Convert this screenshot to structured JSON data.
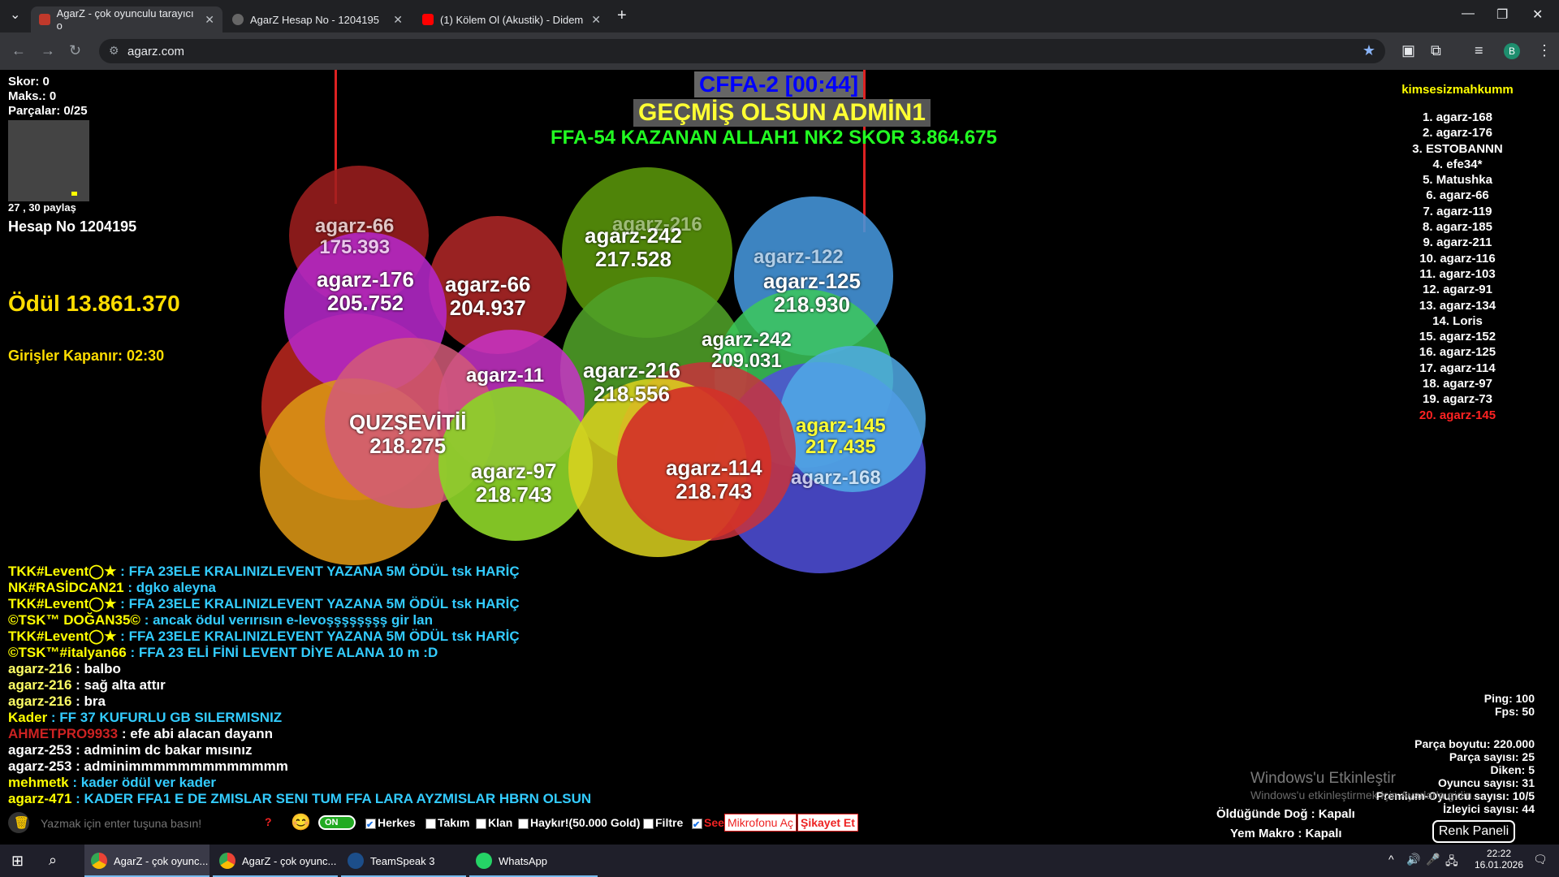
{
  "browser": {
    "tabs": [
      {
        "label": "AgarZ - çok oyunculu tarayıcı o",
        "active": true
      },
      {
        "label": "AgarZ Hesap No - 1204195",
        "active": false
      },
      {
        "label": "(1) Kölem Ol (Akustik) - Didem",
        "active": false
      }
    ],
    "url": "agarz.com"
  },
  "hud": {
    "skor": "Skor: 0",
    "maks": "Maks.: 0",
    "parcalar": "Parçalar: 0/25",
    "coords": "27 , 30 paylaş",
    "hesap": "Hesap No 1204195",
    "odul": "Ödül 13.861.370",
    "girisler": "Girişler Kapanır: 02:30"
  },
  "center": {
    "title": "CFFA-2 [00:44]",
    "message": "GEÇMİŞ OLSUN  ADMİN1",
    "winner": "FFA-54 KAZANAN ALLAH1 NK2 SKOR 3.864.675"
  },
  "cells": [
    {
      "name": "agarz-66",
      "score": "175.393"
    },
    {
      "name": "agarz-176",
      "score": "205.752"
    },
    {
      "name": "agarz-66",
      "score": "204.937"
    },
    {
      "name": "agarz-242",
      "score": "217.528"
    },
    {
      "name": "agarz-216",
      "score": ""
    },
    {
      "name": "agarz-122",
      "score": ""
    },
    {
      "name": "agarz-125",
      "score": "218.930"
    },
    {
      "name": "agarz-242",
      "score": "209.031"
    },
    {
      "name": "agarz-216",
      "score": "218.556"
    },
    {
      "name": "agarz-11",
      "score": ""
    },
    {
      "name": "QUZŞEVİTİİ",
      "score": "218.275"
    },
    {
      "name": "agarz-97",
      "score": "218.743"
    },
    {
      "name": "agarz-114",
      "score": "218.743"
    },
    {
      "name": "agarz-145",
      "score": "217.435"
    },
    {
      "name": "agarz-168",
      "score": ""
    }
  ],
  "leaderboard": {
    "title": "kimsesizmahkumm",
    "items": [
      "1. agarz-168",
      "2. agarz-176",
      "3. ESTOBANNN",
      "4. efe34*",
      "5. Matushka",
      "6. agarz-66",
      "7. agarz-119",
      "8. agarz-185",
      "9. agarz-211",
      "10. agarz-116",
      "11. agarz-103",
      "12. agarz-91",
      "13. agarz-134",
      "14. Loris",
      "15. agarz-152",
      "16. agarz-125",
      "17. agarz-114",
      "18. agarz-97",
      "19. agarz-73",
      "20. agarz-145"
    ]
  },
  "chat": [
    {
      "name": "TKK#Levent◯★",
      "text": "FFA 23ELE KRALINIZLEVENT YAZANA 5M ÖDÜL tsk HARİÇ",
      "name_color": "#ffff00",
      "text_color": "#33ccff"
    },
    {
      "name": "NK#RASİDCAN21",
      "text": "dgko aleyna",
      "name_color": "#ffff00",
      "text_color": "#33ccff"
    },
    {
      "name": "TKK#Levent◯★",
      "text": "FFA 23ELE KRALINIZLEVENT YAZANA 5M ÖDÜL tsk HARİÇ",
      "name_color": "#ffff00",
      "text_color": "#33ccff"
    },
    {
      "name": "©TSK™ DOĞAN35©",
      "text": "ancak ödul verırısın e-levoşşşşşşşş gir lan",
      "name_color": "#ffff00",
      "text_color": "#33ccff"
    },
    {
      "name": "TKK#Levent◯★",
      "text": "FFA 23ELE KRALINIZLEVENT YAZANA 5M ÖDÜL tsk HARİÇ",
      "name_color": "#ffff00",
      "text_color": "#33ccff"
    },
    {
      "name": "©TSK™#italyan66",
      "text": "FFA 23 ELİ FİNİ LEVENT DİYE ALANA 10 m :D",
      "name_color": "#ffff00",
      "text_color": "#33ccff"
    },
    {
      "name": "agarz-216",
      "text": "balbo",
      "name_color": "#ffff66",
      "text_color": "#ffffff"
    },
    {
      "name": "agarz-216",
      "text": "sağ alta attır",
      "name_color": "#ffff66",
      "text_color": "#ffffff"
    },
    {
      "name": "agarz-216",
      "text": "bra",
      "name_color": "#ffff66",
      "text_color": "#ffffff"
    },
    {
      "name": "Kader",
      "text": "FF 37  KUFURLU GB SILERMISNIZ",
      "name_color": "#ffff00",
      "text_color": "#33ccff"
    },
    {
      "name": "AHMETPRO9933",
      "text": "efe abi alacan dayann",
      "name_color": "#cc2222",
      "text_color": "#ffffff"
    },
    {
      "name": "agarz-253",
      "text": "adminim dc bakar mısınız",
      "name_color": "#ffffff",
      "text_color": "#ffffff"
    },
    {
      "name": "agarz-253",
      "text": "adminimmmmmmmmmmmmm",
      "name_color": "#ffffff",
      "text_color": "#ffffff"
    },
    {
      "name": "mehmetk",
      "text": "kader ödül ver kader",
      "name_color": "#ffff00",
      "text_color": "#33ccff"
    },
    {
      "name": "agarz-471",
      "text": "KADER FFA1 E DE ZMISLAR SENI TUM FFA LARA AYZMISLAR HBRN OLSUN",
      "name_color": "#ffff00",
      "text_color": "#33ccff"
    }
  ],
  "stats": {
    "ping": "Ping: 100",
    "fps": "Fps: 50",
    "parca_boyutu": "Parça boyutu: 220.000",
    "parca_sayisi": "Parça sayısı: 25",
    "diken": "Diken: 5",
    "oyuncu": "Oyuncu sayısı: 31",
    "premium": "Premium-Oyuncu sayısı: 10/5",
    "izleyici": "İzleyici sayısı: 44",
    "oldugunde": "Öldüğünde Doğ : Kapalı",
    "yem": "Yem Makro : Kapalı"
  },
  "watermark": {
    "line1": "Windows'u Etkinleştir",
    "line2": "Windows'u etkinleştirmek için Ayarlar'a gidin."
  },
  "chatbar": {
    "placeholder": "Yazmak için enter tuşuna basın!",
    "question": "?",
    "toggle": "ON",
    "herkes": "Herkes",
    "takim": "Takım",
    "klan": "Klan",
    "haykir": "Haykır!(50.000 Gold)",
    "filtre": "Filtre",
    "see": "See",
    "mikrofon": "Mikrofonu Aç",
    "sikayet": "Şikayet Et",
    "renk": "Renk Paneli"
  },
  "taskbar": {
    "apps": [
      "AgarZ - çok oyunc...",
      "AgarZ - çok oyunc...",
      "TeamSpeak 3",
      "WhatsApp"
    ],
    "time": "22:22",
    "date": "16.01.2026"
  },
  "colors": {
    "tab_bg": "#202124",
    "toolbar_bg": "#35363a",
    "leader_last": "#ff2222",
    "accent_yellow": "#ffdd00",
    "winner_green": "#22ff22"
  }
}
